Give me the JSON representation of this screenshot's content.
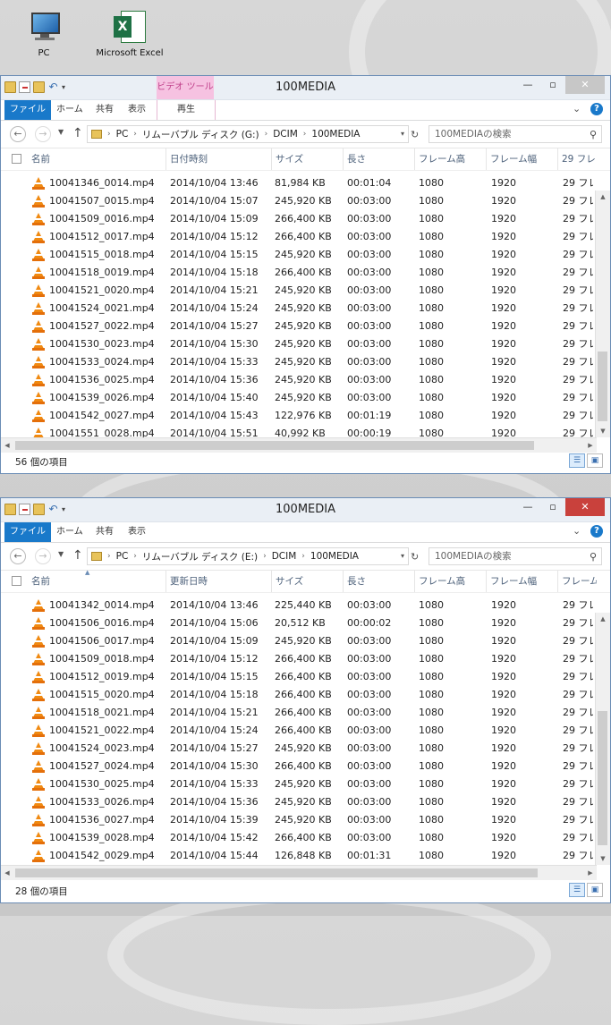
{
  "desktop": {
    "icons": [
      {
        "label": "PC",
        "icon": "pc-icon"
      },
      {
        "label": "Microsoft Excel",
        "icon": "excel-icon"
      }
    ]
  },
  "ribbon_tabs": {
    "file": "ファイル",
    "home": "ホーム",
    "share": "共有",
    "view": "表示"
  },
  "win1": {
    "title": "100MEDIA",
    "context_tab": "ビデオ ツール",
    "play_tab": "再生",
    "breadcrumb": [
      "PC",
      "リムーバブル ディスク (G:)",
      "DCIM",
      "100MEDIA"
    ],
    "search_placeholder": "100MEDIAの検索",
    "columns": [
      "名前",
      "日付時刻",
      "サイズ",
      "長さ",
      "フレーム高",
      "フレーム幅",
      "29 フレ"
    ],
    "rows": [
      {
        "name": "10041346_0014.mp4",
        "date": "2014/10/04 13:46",
        "size": "81,984 KB",
        "length": "00:01:04",
        "height": "1080",
        "width": "1920",
        "rate": "29 フレ"
      },
      {
        "name": "10041507_0015.mp4",
        "date": "2014/10/04 15:07",
        "size": "245,920 KB",
        "length": "00:03:00",
        "height": "1080",
        "width": "1920",
        "rate": "29 フレ"
      },
      {
        "name": "10041509_0016.mp4",
        "date": "2014/10/04 15:09",
        "size": "266,400 KB",
        "length": "00:03:00",
        "height": "1080",
        "width": "1920",
        "rate": "29 フレ"
      },
      {
        "name": "10041512_0017.mp4",
        "date": "2014/10/04 15:12",
        "size": "266,400 KB",
        "length": "00:03:00",
        "height": "1080",
        "width": "1920",
        "rate": "29 フレ"
      },
      {
        "name": "10041515_0018.mp4",
        "date": "2014/10/04 15:15",
        "size": "245,920 KB",
        "length": "00:03:00",
        "height": "1080",
        "width": "1920",
        "rate": "29 フレ"
      },
      {
        "name": "10041518_0019.mp4",
        "date": "2014/10/04 15:18",
        "size": "266,400 KB",
        "length": "00:03:00",
        "height": "1080",
        "width": "1920",
        "rate": "29 フレ"
      },
      {
        "name": "10041521_0020.mp4",
        "date": "2014/10/04 15:21",
        "size": "245,920 KB",
        "length": "00:03:00",
        "height": "1080",
        "width": "1920",
        "rate": "29 フレ"
      },
      {
        "name": "10041524_0021.mp4",
        "date": "2014/10/04 15:24",
        "size": "245,920 KB",
        "length": "00:03:00",
        "height": "1080",
        "width": "1920",
        "rate": "29 フレ"
      },
      {
        "name": "10041527_0022.mp4",
        "date": "2014/10/04 15:27",
        "size": "245,920 KB",
        "length": "00:03:00",
        "height": "1080",
        "width": "1920",
        "rate": "29 フレ"
      },
      {
        "name": "10041530_0023.mp4",
        "date": "2014/10/04 15:30",
        "size": "245,920 KB",
        "length": "00:03:00",
        "height": "1080",
        "width": "1920",
        "rate": "29 フレ"
      },
      {
        "name": "10041533_0024.mp4",
        "date": "2014/10/04 15:33",
        "size": "245,920 KB",
        "length": "00:03:00",
        "height": "1080",
        "width": "1920",
        "rate": "29 フレ"
      },
      {
        "name": "10041536_0025.mp4",
        "date": "2014/10/04 15:36",
        "size": "245,920 KB",
        "length": "00:03:00",
        "height": "1080",
        "width": "1920",
        "rate": "29 フレ"
      },
      {
        "name": "10041539_0026.mp4",
        "date": "2014/10/04 15:40",
        "size": "245,920 KB",
        "length": "00:03:00",
        "height": "1080",
        "width": "1920",
        "rate": "29 フレ"
      },
      {
        "name": "10041542_0027.mp4",
        "date": "2014/10/04 15:43",
        "size": "122,976 KB",
        "length": "00:01:19",
        "height": "1080",
        "width": "1920",
        "rate": "29 フレ"
      },
      {
        "name": "10041551_0028.mp4",
        "date": "2014/10/04 15:51",
        "size": "40,992 KB",
        "length": "00:00:19",
        "height": "1080",
        "width": "1920",
        "rate": "29 フレ"
      }
    ],
    "status": "56 個の項目"
  },
  "win2": {
    "title": "100MEDIA",
    "breadcrumb": [
      "PC",
      "リムーバブル ディスク (E:)",
      "DCIM",
      "100MEDIA"
    ],
    "search_placeholder": "100MEDIAの検索",
    "columns": [
      "名前",
      "更新日時",
      "サイズ",
      "長さ",
      "フレーム高",
      "フレーム幅",
      "フレーム"
    ],
    "rows": [
      {
        "name": "10041342_0014.mp4",
        "date": "2014/10/04 13:46",
        "size": "225,440 KB",
        "length": "00:03:00",
        "height": "1080",
        "width": "1920",
        "rate": "29 フレ"
      },
      {
        "name": "10041506_0016.mp4",
        "date": "2014/10/04 15:06",
        "size": "20,512 KB",
        "length": "00:00:02",
        "height": "1080",
        "width": "1920",
        "rate": "29 フレ"
      },
      {
        "name": "10041506_0017.mp4",
        "date": "2014/10/04 15:09",
        "size": "245,920 KB",
        "length": "00:03:00",
        "height": "1080",
        "width": "1920",
        "rate": "29 フレ"
      },
      {
        "name": "10041509_0018.mp4",
        "date": "2014/10/04 15:12",
        "size": "266,400 KB",
        "length": "00:03:00",
        "height": "1080",
        "width": "1920",
        "rate": "29 フレ"
      },
      {
        "name": "10041512_0019.mp4",
        "date": "2014/10/04 15:15",
        "size": "266,400 KB",
        "length": "00:03:00",
        "height": "1080",
        "width": "1920",
        "rate": "29 フレ"
      },
      {
        "name": "10041515_0020.mp4",
        "date": "2014/10/04 15:18",
        "size": "266,400 KB",
        "length": "00:03:00",
        "height": "1080",
        "width": "1920",
        "rate": "29 フレ"
      },
      {
        "name": "10041518_0021.mp4",
        "date": "2014/10/04 15:21",
        "size": "266,400 KB",
        "length": "00:03:00",
        "height": "1080",
        "width": "1920",
        "rate": "29 フレ"
      },
      {
        "name": "10041521_0022.mp4",
        "date": "2014/10/04 15:24",
        "size": "266,400 KB",
        "length": "00:03:00",
        "height": "1080",
        "width": "1920",
        "rate": "29 フレ"
      },
      {
        "name": "10041524_0023.mp4",
        "date": "2014/10/04 15:27",
        "size": "245,920 KB",
        "length": "00:03:00",
        "height": "1080",
        "width": "1920",
        "rate": "29 フレ"
      },
      {
        "name": "10041527_0024.mp4",
        "date": "2014/10/04 15:30",
        "size": "266,400 KB",
        "length": "00:03:00",
        "height": "1080",
        "width": "1920",
        "rate": "29 フレ"
      },
      {
        "name": "10041530_0025.mp4",
        "date": "2014/10/04 15:33",
        "size": "245,920 KB",
        "length": "00:03:00",
        "height": "1080",
        "width": "1920",
        "rate": "29 フレ"
      },
      {
        "name": "10041533_0026.mp4",
        "date": "2014/10/04 15:36",
        "size": "245,920 KB",
        "length": "00:03:00",
        "height": "1080",
        "width": "1920",
        "rate": "29 フレ"
      },
      {
        "name": "10041536_0027.mp4",
        "date": "2014/10/04 15:39",
        "size": "245,920 KB",
        "length": "00:03:00",
        "height": "1080",
        "width": "1920",
        "rate": "29 フレ"
      },
      {
        "name": "10041539_0028.mp4",
        "date": "2014/10/04 15:42",
        "size": "266,400 KB",
        "length": "00:03:00",
        "height": "1080",
        "width": "1920",
        "rate": "29 フレ"
      },
      {
        "name": "10041542_0029.mp4",
        "date": "2014/10/04 15:44",
        "size": "126,848 KB",
        "length": "00:01:31",
        "height": "1080",
        "width": "1920",
        "rate": "29 フレ"
      }
    ],
    "status": "28 個の項目"
  },
  "colors": {
    "accent": "#1979ca",
    "context_tab": "#f6c2e1",
    "close_active": "#c9413c",
    "vlc_orange": "#f08a12"
  }
}
